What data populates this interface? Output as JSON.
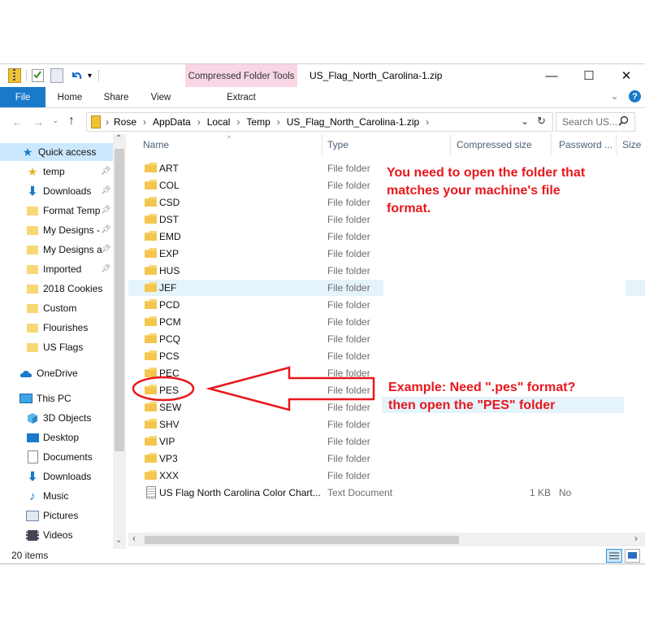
{
  "window": {
    "title": "US_Flag_North_Carolina-1.zip",
    "context_tab": "Compressed Folder Tools",
    "minimize": "—",
    "maximize": "☐",
    "close": "✕"
  },
  "ribbon": {
    "tabs": [
      "File",
      "Home",
      "Share",
      "View",
      "Extract"
    ]
  },
  "address": {
    "path": [
      "Rose",
      "AppData",
      "Local",
      "Temp",
      "US_Flag_North_Carolina-1.zip"
    ],
    "search_placeholder": "Search US..."
  },
  "nav": {
    "quick_access": "Quick access",
    "items": [
      {
        "label": "temp",
        "icon": "star-folder-icon",
        "pinned": true
      },
      {
        "label": "Downloads",
        "icon": "download-arrow-icon",
        "pinned": true
      },
      {
        "label": "Format Temp",
        "icon": "folder-icon",
        "pinned": true
      },
      {
        "label": "My Designs -",
        "icon": "folder-icon",
        "pinned": true
      },
      {
        "label": "My Designs a",
        "icon": "folder-icon",
        "pinned": true
      },
      {
        "label": "Imported",
        "icon": "folder-icon",
        "pinned": true
      },
      {
        "label": "2018 Cookies",
        "icon": "folder-icon",
        "pinned": false
      },
      {
        "label": "Custom",
        "icon": "folder-icon",
        "pinned": false
      },
      {
        "label": "Flourishes",
        "icon": "folder-icon",
        "pinned": false
      },
      {
        "label": "US Flags",
        "icon": "folder-icon",
        "pinned": false
      }
    ],
    "onedrive": "OneDrive",
    "this_pc": "This PC",
    "pc_items": [
      {
        "label": "3D Objects",
        "icon": "cube-icon"
      },
      {
        "label": "Desktop",
        "icon": "desktop-icon"
      },
      {
        "label": "Documents",
        "icon": "document-icon"
      },
      {
        "label": "Downloads",
        "icon": "download-arrow-icon"
      },
      {
        "label": "Music",
        "icon": "music-note-icon"
      },
      {
        "label": "Pictures",
        "icon": "picture-icon"
      },
      {
        "label": "Videos",
        "icon": "film-icon"
      }
    ]
  },
  "columns": [
    "Name",
    "Type",
    "Compressed size",
    "Password ...",
    "Size"
  ],
  "files": [
    {
      "name": "ART",
      "type": "File folder",
      "size": "",
      "password": ""
    },
    {
      "name": "COL",
      "type": "File folder",
      "size": "",
      "password": ""
    },
    {
      "name": "CSD",
      "type": "File folder",
      "size": "",
      "password": ""
    },
    {
      "name": "DST",
      "type": "File folder",
      "size": "",
      "password": ""
    },
    {
      "name": "EMD",
      "type": "File folder",
      "size": "",
      "password": ""
    },
    {
      "name": "EXP",
      "type": "File folder",
      "size": "",
      "password": ""
    },
    {
      "name": "HUS",
      "type": "File folder",
      "size": "",
      "password": ""
    },
    {
      "name": "JEF",
      "type": "File folder",
      "size": "",
      "password": ""
    },
    {
      "name": "PCD",
      "type": "File folder",
      "size": "",
      "password": ""
    },
    {
      "name": "PCM",
      "type": "File folder",
      "size": "",
      "password": ""
    },
    {
      "name": "PCQ",
      "type": "File folder",
      "size": "",
      "password": ""
    },
    {
      "name": "PCS",
      "type": "File folder",
      "size": "",
      "password": ""
    },
    {
      "name": "PEC",
      "type": "File folder",
      "size": "",
      "password": ""
    },
    {
      "name": "PES",
      "type": "File folder",
      "size": "",
      "password": ""
    },
    {
      "name": "SEW",
      "type": "File folder",
      "size": "",
      "password": ""
    },
    {
      "name": "SHV",
      "type": "File folder",
      "size": "",
      "password": ""
    },
    {
      "name": "VIP",
      "type": "File folder",
      "size": "",
      "password": ""
    },
    {
      "name": "VP3",
      "type": "File folder",
      "size": "",
      "password": ""
    },
    {
      "name": "XXX",
      "type": "File folder",
      "size": "",
      "password": ""
    },
    {
      "name": "US Flag North Carolina Color Chart...",
      "type": "Text Document",
      "size": "1 KB",
      "password": "No"
    }
  ],
  "status": {
    "count": "20 items"
  },
  "annotations": {
    "top": [
      "You need to open the folder that",
      "matches your machine's file",
      "format."
    ],
    "bottom": [
      "Example: Need \".pes\" format?",
      "then open the \"PES\" folder"
    ]
  },
  "colors": {
    "accent": "#1979ca",
    "annotation": "#e8171d",
    "context_tab": "#f8d6e6",
    "selected_row": "#e5f3fb",
    "folder": "#f8d775"
  }
}
